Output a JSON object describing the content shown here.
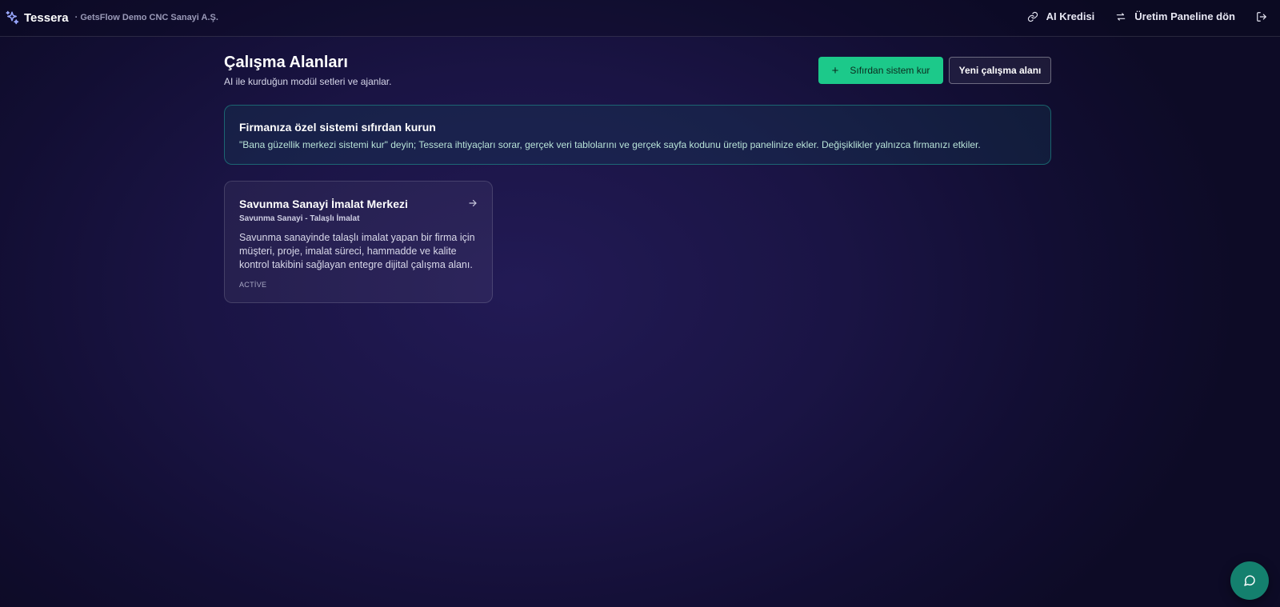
{
  "header": {
    "brand_name": "Tessera",
    "company": "· GetsFlow Demo CNC Sanayi A.Ş.",
    "nav": {
      "ai_credit": "AI Kredisi",
      "back_to_panel": "Üretim Paneline dön"
    },
    "icons": [
      "sparkle-icon",
      "link-icon",
      "swap-arrows-icon",
      "logout-icon"
    ]
  },
  "page": {
    "title": "Çalışma Alanları",
    "subtitle": "AI ile kurduğun modül setleri ve ajanlar.",
    "primary_button": "Sıfırdan sistem kur",
    "secondary_button": "Yeni çalışma alanı"
  },
  "info": {
    "title": "Firmanıza özel sistemi sıfırdan kurun",
    "text": "\"Bana güzellik merkezi sistemi kur\" deyin; Tessera ihtiyaçları sorar, gerçek veri tablolarını ve gerçek sayfa kodunu üretip panelinize ekler. Değişiklikler yalnızca firmanızı etkiler."
  },
  "workspaces": [
    {
      "title": "Savunma Sanayi İmalat Merkezi",
      "category": "Savunma Sanayi - Talaşlı İmalat",
      "description": "Savunma sanayinde talaşlı imalat yapan bir firma için müşteri, proje, imalat süreci, hammadde ve kalite kontrol takibini sağlayan entegre dijital çalışma alanı.",
      "status": "ACTİVE"
    }
  ],
  "colors": {
    "accent_green": "#1cc98a",
    "chat_button": "#14806e",
    "info_border": "#20a096"
  }
}
